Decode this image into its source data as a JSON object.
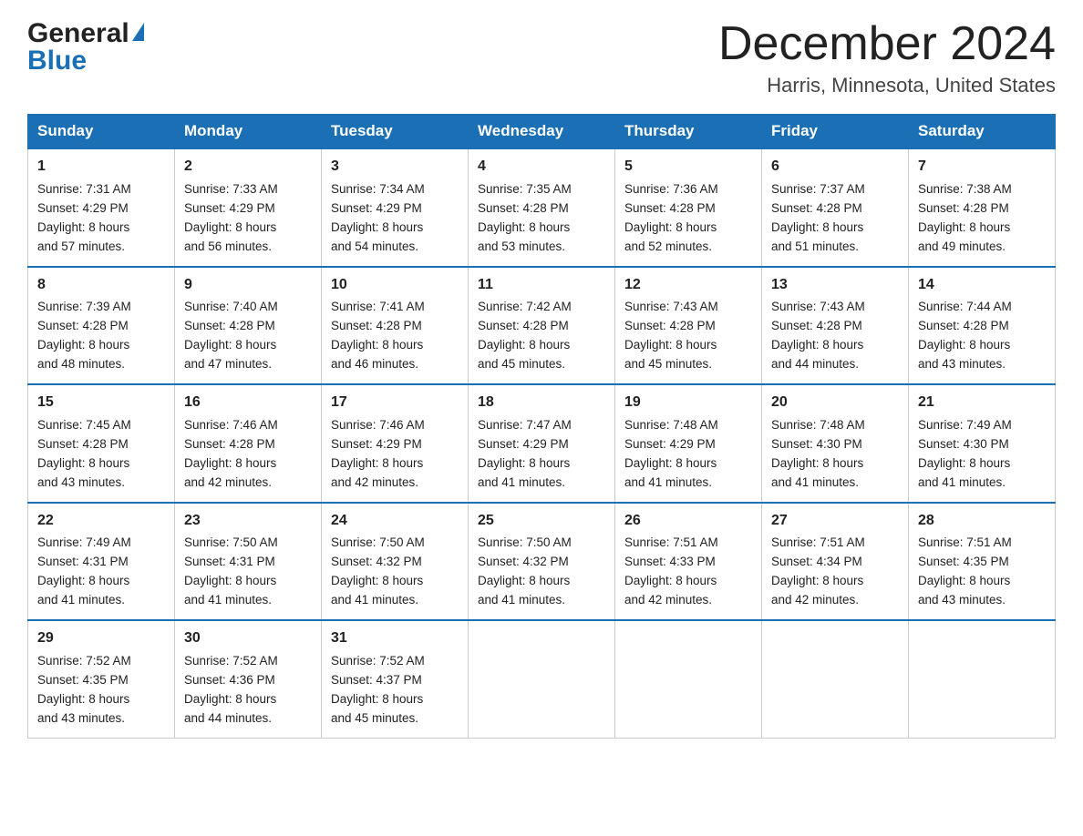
{
  "header": {
    "logo_general": "General",
    "logo_blue": "Blue",
    "month_title": "December 2024",
    "location": "Harris, Minnesota, United States"
  },
  "weekdays": [
    "Sunday",
    "Monday",
    "Tuesday",
    "Wednesday",
    "Thursday",
    "Friday",
    "Saturday"
  ],
  "weeks": [
    [
      {
        "day": "1",
        "sunrise": "7:31 AM",
        "sunset": "4:29 PM",
        "daylight": "8 hours and 57 minutes."
      },
      {
        "day": "2",
        "sunrise": "7:33 AM",
        "sunset": "4:29 PM",
        "daylight": "8 hours and 56 minutes."
      },
      {
        "day": "3",
        "sunrise": "7:34 AM",
        "sunset": "4:29 PM",
        "daylight": "8 hours and 54 minutes."
      },
      {
        "day": "4",
        "sunrise": "7:35 AM",
        "sunset": "4:28 PM",
        "daylight": "8 hours and 53 minutes."
      },
      {
        "day": "5",
        "sunrise": "7:36 AM",
        "sunset": "4:28 PM",
        "daylight": "8 hours and 52 minutes."
      },
      {
        "day": "6",
        "sunrise": "7:37 AM",
        "sunset": "4:28 PM",
        "daylight": "8 hours and 51 minutes."
      },
      {
        "day": "7",
        "sunrise": "7:38 AM",
        "sunset": "4:28 PM",
        "daylight": "8 hours and 49 minutes."
      }
    ],
    [
      {
        "day": "8",
        "sunrise": "7:39 AM",
        "sunset": "4:28 PM",
        "daylight": "8 hours and 48 minutes."
      },
      {
        "day": "9",
        "sunrise": "7:40 AM",
        "sunset": "4:28 PM",
        "daylight": "8 hours and 47 minutes."
      },
      {
        "day": "10",
        "sunrise": "7:41 AM",
        "sunset": "4:28 PM",
        "daylight": "8 hours and 46 minutes."
      },
      {
        "day": "11",
        "sunrise": "7:42 AM",
        "sunset": "4:28 PM",
        "daylight": "8 hours and 45 minutes."
      },
      {
        "day": "12",
        "sunrise": "7:43 AM",
        "sunset": "4:28 PM",
        "daylight": "8 hours and 45 minutes."
      },
      {
        "day": "13",
        "sunrise": "7:43 AM",
        "sunset": "4:28 PM",
        "daylight": "8 hours and 44 minutes."
      },
      {
        "day": "14",
        "sunrise": "7:44 AM",
        "sunset": "4:28 PM",
        "daylight": "8 hours and 43 minutes."
      }
    ],
    [
      {
        "day": "15",
        "sunrise": "7:45 AM",
        "sunset": "4:28 PM",
        "daylight": "8 hours and 43 minutes."
      },
      {
        "day": "16",
        "sunrise": "7:46 AM",
        "sunset": "4:28 PM",
        "daylight": "8 hours and 42 minutes."
      },
      {
        "day": "17",
        "sunrise": "7:46 AM",
        "sunset": "4:29 PM",
        "daylight": "8 hours and 42 minutes."
      },
      {
        "day": "18",
        "sunrise": "7:47 AM",
        "sunset": "4:29 PM",
        "daylight": "8 hours and 41 minutes."
      },
      {
        "day": "19",
        "sunrise": "7:48 AM",
        "sunset": "4:29 PM",
        "daylight": "8 hours and 41 minutes."
      },
      {
        "day": "20",
        "sunrise": "7:48 AM",
        "sunset": "4:30 PM",
        "daylight": "8 hours and 41 minutes."
      },
      {
        "day": "21",
        "sunrise": "7:49 AM",
        "sunset": "4:30 PM",
        "daylight": "8 hours and 41 minutes."
      }
    ],
    [
      {
        "day": "22",
        "sunrise": "7:49 AM",
        "sunset": "4:31 PM",
        "daylight": "8 hours and 41 minutes."
      },
      {
        "day": "23",
        "sunrise": "7:50 AM",
        "sunset": "4:31 PM",
        "daylight": "8 hours and 41 minutes."
      },
      {
        "day": "24",
        "sunrise": "7:50 AM",
        "sunset": "4:32 PM",
        "daylight": "8 hours and 41 minutes."
      },
      {
        "day": "25",
        "sunrise": "7:50 AM",
        "sunset": "4:32 PM",
        "daylight": "8 hours and 41 minutes."
      },
      {
        "day": "26",
        "sunrise": "7:51 AM",
        "sunset": "4:33 PM",
        "daylight": "8 hours and 42 minutes."
      },
      {
        "day": "27",
        "sunrise": "7:51 AM",
        "sunset": "4:34 PM",
        "daylight": "8 hours and 42 minutes."
      },
      {
        "day": "28",
        "sunrise": "7:51 AM",
        "sunset": "4:35 PM",
        "daylight": "8 hours and 43 minutes."
      }
    ],
    [
      {
        "day": "29",
        "sunrise": "7:52 AM",
        "sunset": "4:35 PM",
        "daylight": "8 hours and 43 minutes."
      },
      {
        "day": "30",
        "sunrise": "7:52 AM",
        "sunset": "4:36 PM",
        "daylight": "8 hours and 44 minutes."
      },
      {
        "day": "31",
        "sunrise": "7:52 AM",
        "sunset": "4:37 PM",
        "daylight": "8 hours and 45 minutes."
      },
      null,
      null,
      null,
      null
    ]
  ],
  "labels": {
    "sunrise": "Sunrise:",
    "sunset": "Sunset:",
    "daylight": "Daylight:"
  }
}
